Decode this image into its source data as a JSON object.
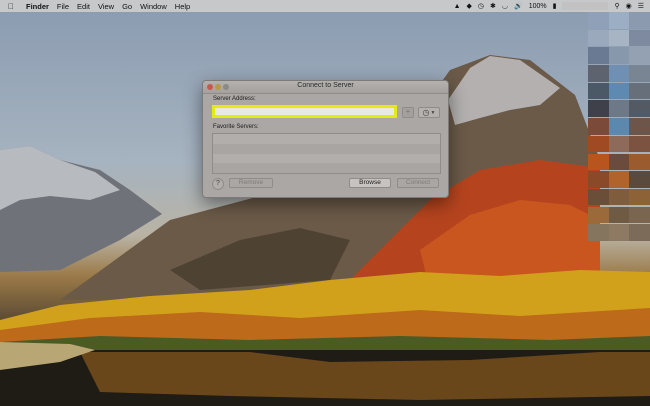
{
  "menubar": {
    "apple_icon": "apple-icon",
    "app_name": "Finder",
    "menus": [
      "File",
      "Edit",
      "View",
      "Go",
      "Window",
      "Help"
    ],
    "battery": "100%"
  },
  "dialog": {
    "title": "Connect to Server",
    "server_address_label": "Server Address:",
    "server_address_value": "",
    "favorites_label": "Favorite Servers:",
    "favorites": [],
    "help_label": "?",
    "remove_label": "Remove",
    "browse_label": "Browse",
    "connect_label": "Connect",
    "add_label": "+"
  },
  "colors": {
    "highlight": "#e6ea14",
    "close": "#c8584d",
    "minimize": "#b89a46",
    "dialog_bg": "#aaa7a4"
  }
}
